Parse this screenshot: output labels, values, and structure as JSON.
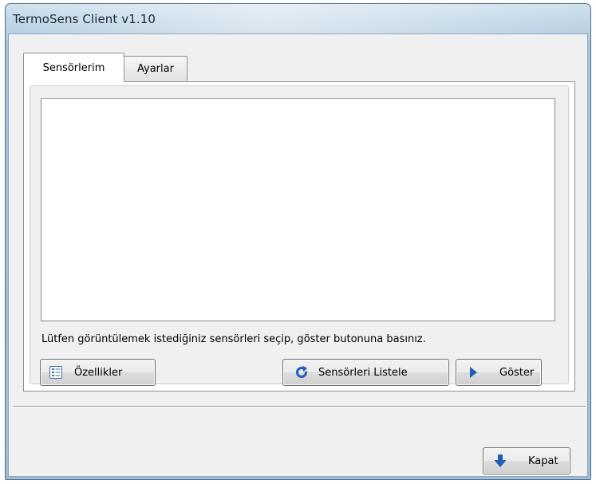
{
  "window": {
    "title": "TermoSens Client v1.10"
  },
  "tabs": [
    {
      "label": "Sensörlerim",
      "active": true
    },
    {
      "label": "Ayarlar",
      "active": false
    }
  ],
  "sensors_tab": {
    "list_items": [],
    "hint": "Lütfen görüntülemek istediğiniz sensörleri seçip, göster butonuna basınız.",
    "buttons": {
      "properties": {
        "label": "Özellikler",
        "icon": "properties-list-icon"
      },
      "list_sensors": {
        "label": "Sensörleri Listele",
        "icon": "refresh-icon"
      },
      "show": {
        "label": "Göster",
        "icon": "play-arrow-icon"
      }
    }
  },
  "footer": {
    "close": {
      "label": "Kapat",
      "icon": "down-arrow-icon"
    }
  },
  "colors": {
    "title_bar": "#a9c5da",
    "icon_blue": "#1f5fb8",
    "client_bg": "#f0f0f0"
  }
}
